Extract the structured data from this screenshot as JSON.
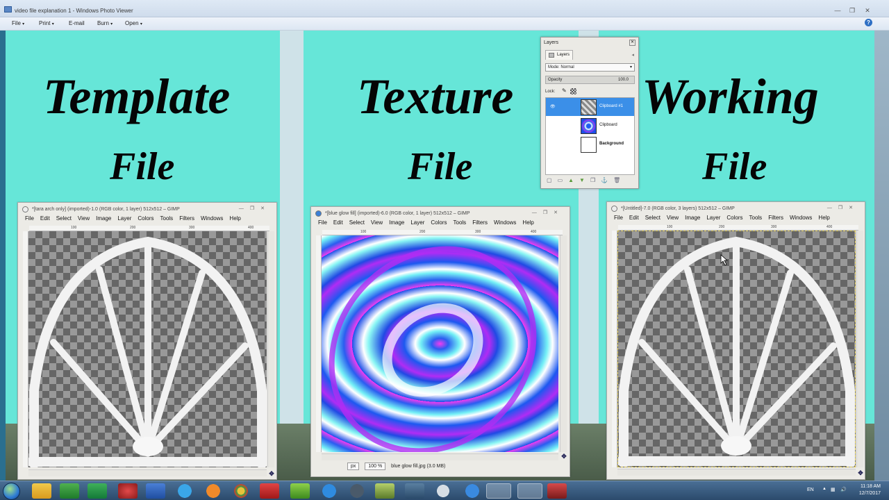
{
  "photo_viewer": {
    "title": "video file explanation 1 - Windows Photo Viewer",
    "window_buttons": [
      "—",
      "❐",
      "✕"
    ],
    "menu": [
      {
        "label": "File",
        "arrow": "▾"
      },
      {
        "label": "Print",
        "arrow": "▾"
      },
      {
        "label": "E-mail",
        "arrow": ""
      },
      {
        "label": "Burn",
        "arrow": "▾"
      },
      {
        "label": "Open",
        "arrow": "▾"
      }
    ],
    "help_label": "?"
  },
  "headings": {
    "template_line1": "Template",
    "template_line2": "File",
    "texture_line1": "Texture",
    "texture_line2": "File",
    "working_line1": "Working",
    "working_line2": "File"
  },
  "gimp_menu": [
    "File",
    "Edit",
    "Select",
    "View",
    "Image",
    "Layer",
    "Colors",
    "Tools",
    "Filters",
    "Windows",
    "Help"
  ],
  "win1": {
    "title": "*[tara arch only] (imported)-1.0 (RGB color, 1 layer) 512x512 – GIMP",
    "ruler": [
      "100",
      "200",
      "300",
      "400"
    ]
  },
  "win2": {
    "title": "*[blue glow fill] (imported)-6.0 (RGB color, 1 layer) 512x512 – GIMP",
    "ruler": [
      "100",
      "200",
      "300",
      "400"
    ],
    "unit": "px",
    "zoom": "100 %",
    "status": "blue glow fill.jpg (3.0 MB)"
  },
  "win3": {
    "title": "*[Untitled]-7.0 (RGB color, 3 layers) 512x512 – GIMP",
    "ruler": [
      "100",
      "200",
      "300",
      "400"
    ]
  },
  "layers_dialog": {
    "title": "Layers",
    "tab": "Layers",
    "mode": "Mode: Normal",
    "opacity_label": "Opacity",
    "opacity_value": "100.0",
    "lock_label": "Lock:",
    "layers": [
      {
        "name": "Clipboard #1",
        "selected": true
      },
      {
        "name": "Clipboard",
        "selected": false
      },
      {
        "name": "Background",
        "selected": false
      }
    ]
  },
  "tray": {
    "lang": "EN",
    "time": "11:18 AM",
    "date": "12/7/2017"
  },
  "colors": {
    "panel": "#66e6d8",
    "selection": "#3b8fe8",
    "taskbar": "#2b4a6c"
  }
}
